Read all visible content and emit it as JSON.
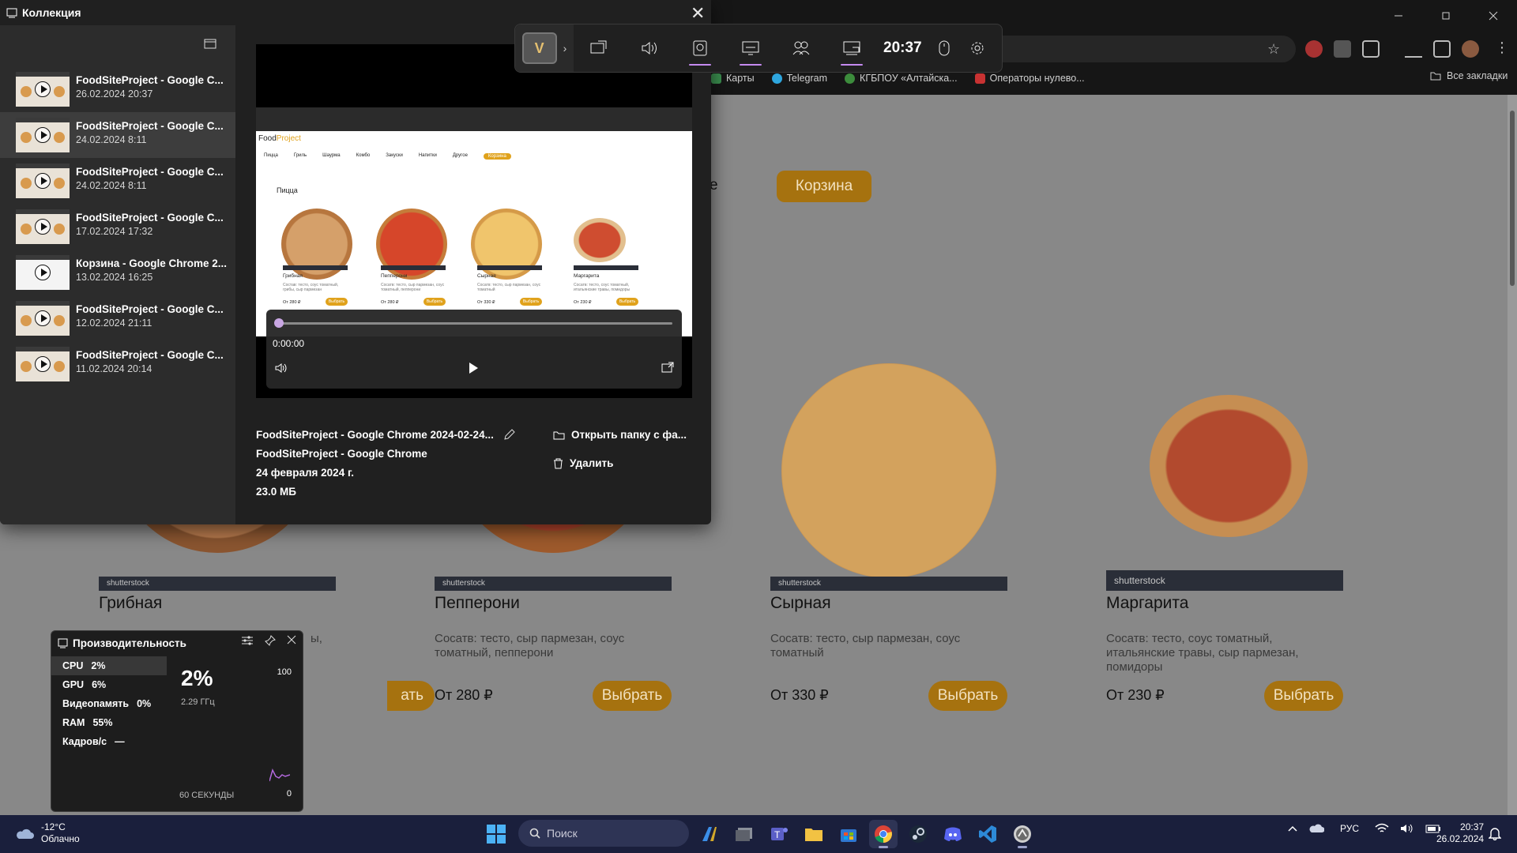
{
  "browser": {
    "bookmarks": [
      "Карты",
      "Telegram",
      "КГБПОУ «Алтайска...",
      "Операторы нулево..."
    ],
    "all_bookmarks": "Все закладки",
    "page_partial_text": "е",
    "cart_button": "Корзина",
    "pizzas": [
      {
        "name": "Грибная",
        "desc": "",
        "price": "",
        "button": "Выбрать",
        "watermark": "shutterstock"
      },
      {
        "name": "Пепперони",
        "desc": "Сосатв: тесто, сыр пармезан, соус томатный, пепперони",
        "price": "От 280 ₽",
        "button": "Выбрать",
        "watermark": "shutterstock"
      },
      {
        "name": "Сырная",
        "desc": "Сосатв: тесто, сыр пармезан, соус томатный",
        "price": "От 330 ₽",
        "button": "Выбрать",
        "watermark": "shutterstock"
      },
      {
        "name": "Маргарита",
        "desc": "Сосатв: тесто, соус томатный, итальянские травы, сыр пармезан, помидоры",
        "price": "От 230 ₽",
        "button": "Выбрать",
        "watermark": "shutterstock"
      }
    ],
    "visible_partial": {
      "mushroom_desc_tail": "ы,",
      "mushroom_button_tail": "ать"
    }
  },
  "collection": {
    "title": "Коллекция",
    "clips": [
      {
        "title": "FoodSiteProject - Google C...",
        "date": "26.02.2024 20:37"
      },
      {
        "title": "FoodSiteProject - Google C...",
        "date": "24.02.2024 8:11"
      },
      {
        "title": "FoodSiteProject - Google C...",
        "date": "24.02.2024 8:11"
      },
      {
        "title": "FoodSiteProject - Google C...",
        "date": "17.02.2024 17:32"
      },
      {
        "title": "Корзина - Google Chrome 2...",
        "date": "13.02.2024 16:25"
      },
      {
        "title": "FoodSiteProject - Google C...",
        "date": "12.02.2024 21:11"
      },
      {
        "title": "FoodSiteProject - Google C...",
        "date": "11.02.2024 20:14"
      }
    ],
    "selected_index": 1,
    "preview": {
      "logo_a": "Food",
      "logo_b": "Project",
      "nav": [
        "Пицца",
        "Гриль",
        "Шаурма",
        "Комбо",
        "Закуски",
        "Напитки",
        "Другое",
        "Корзина"
      ],
      "heading": "Пицца",
      "items": [
        {
          "name": "Грибная",
          "price": "От 280 ₽",
          "btn": "Выбрать",
          "desc": "Состав: тесто, соус томатный, грибы, сыр пармезан"
        },
        {
          "name": "Пепперони",
          "price": "От 280 ₽",
          "btn": "Выбрать",
          "desc": "Сосатв: тесто, сыр пармезан, соус томатный, пепперони"
        },
        {
          "name": "Сырная",
          "price": "От 330 ₽",
          "btn": "Выбрать",
          "desc": "Сосатв: тесто, сыр пармезан, соус томатный"
        },
        {
          "name": "Маргарита",
          "price": "От 230 ₽",
          "btn": "Выбрать",
          "desc": "Сосатв: тесто, соус томатный, итальянские травы, помидоры"
        }
      ]
    },
    "player": {
      "time": "0:00:00",
      "progress": 0
    },
    "details": {
      "file_title": "FoodSiteProject - Google Chrome 2024-02-24...",
      "app": "FoodSiteProject - Google Chrome",
      "date": "24 февраля 2024 г.",
      "size": "23.0 МБ",
      "open_folder": "Открыть папку с фа...",
      "delete": "Удалить"
    }
  },
  "gamebar": {
    "app_letter": "V",
    "time": "20:37",
    "widgets": [
      "capture-icon",
      "audio-icon",
      "performance-icon",
      "resources-icon",
      "xbox-social-icon",
      "gallery-icon"
    ],
    "accent": "#c58af0"
  },
  "performance": {
    "title": "Производительность",
    "rows": [
      {
        "label": "CPU",
        "value": "2%"
      },
      {
        "label": "GPU",
        "value": "6%"
      },
      {
        "label": "Видеопамять",
        "value": "0%"
      },
      {
        "label": "RAM",
        "value": "55%"
      },
      {
        "label": "Кадров/с",
        "value": "—"
      }
    ],
    "big_value": "2%",
    "frequency": "2.29 ГГц",
    "max": "100",
    "min": "0",
    "window": "60 СЕКУНДЫ"
  },
  "taskbar": {
    "temp": "-12°C",
    "weather": "Облачно",
    "search_placeholder": "Поиск",
    "lang": "РУС",
    "time": "20:37",
    "date": "26.02.2024"
  }
}
